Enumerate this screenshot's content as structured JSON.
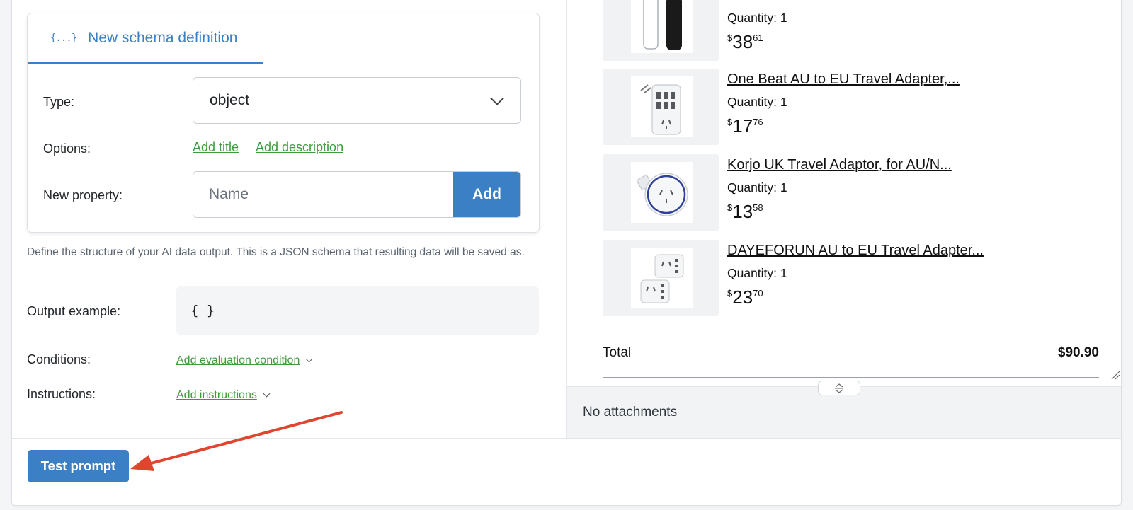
{
  "schema": {
    "tab_label": "New schema definition",
    "tab_icon": "{...}",
    "type_label": "Type:",
    "type_value": "object",
    "options_label": "Options:",
    "add_title": "Add title",
    "add_description": "Add description",
    "new_property_label": "New property:",
    "property_placeholder": "Name",
    "add_button": "Add"
  },
  "help_text": "Define the structure of your AI data output. This is a JSON schema that resulting data will be saved as.",
  "output": {
    "label": "Output example:",
    "value": "{ }"
  },
  "conditions": {
    "label": "Conditions:",
    "link": "Add evaluation condition"
  },
  "instructions": {
    "label": "Instructions:",
    "link": "Add instructions"
  },
  "cart": {
    "items": [
      {
        "title": "",
        "quantity": "Quantity: 1",
        "currency": "$",
        "whole": "38",
        "cents": "61",
        "icon": "water-bottle-icon"
      },
      {
        "title": "One Beat AU to EU Travel Adapter,...",
        "quantity": "Quantity: 1",
        "currency": "$",
        "whole": "17",
        "cents": "76",
        "icon": "power-strip-icon"
      },
      {
        "title": "Korjo UK Travel Adaptor, for AU/N...",
        "quantity": "Quantity: 1",
        "currency": "$",
        "whole": "13",
        "cents": "58",
        "icon": "plug-adapter-icon"
      },
      {
        "title": "DAYEFORUN AU to EU Travel Adapter...",
        "quantity": "Quantity: 1",
        "currency": "$",
        "whole": "23",
        "cents": "70",
        "icon": "double-adapter-icon"
      }
    ],
    "total_label": "Total",
    "total_value": "$90.90"
  },
  "attachments_text": "No attachments",
  "footer": {
    "test_button": "Test prompt"
  },
  "colors": {
    "accent": "#3b7fc4",
    "link": "#3f9a3f",
    "annotation_arrow": "#e0452f"
  }
}
